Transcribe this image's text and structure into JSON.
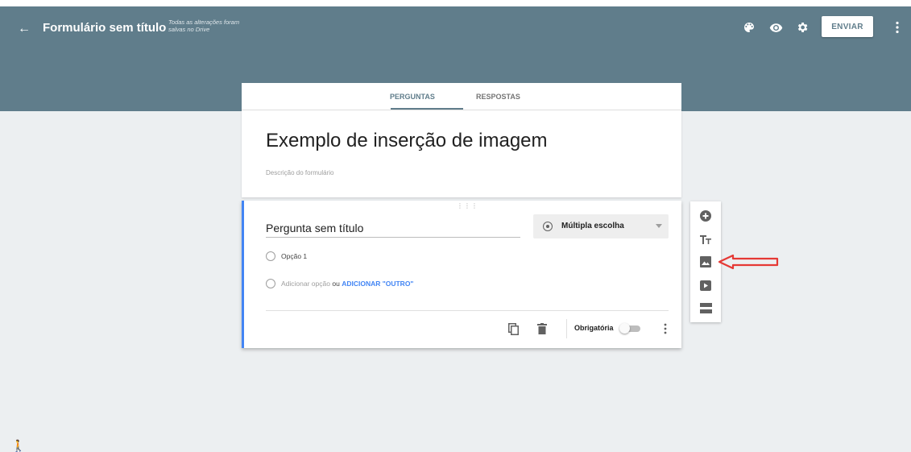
{
  "header": {
    "title": "Formulário sem título",
    "save_status": "Todas as alterações foram salvas no Drive",
    "send_label": "ENVIAR",
    "icons": [
      "back-arrow-icon",
      "palette-icon",
      "preview-eye-icon",
      "settings-gear-icon",
      "more-vert-icon"
    ]
  },
  "tabs": [
    {
      "label": "PERGUNTAS",
      "active": true
    },
    {
      "label": "RESPOSTAS",
      "active": false
    }
  ],
  "form": {
    "heading": "Exemplo de inserção de imagem",
    "description_placeholder": "Descrição do formulário"
  },
  "question": {
    "title": "Pergunta sem título",
    "type": "Múltipla escolha",
    "options": [
      "Opção 1"
    ],
    "add_option": "Adicionar opção",
    "or": "ou",
    "add_other": "ADICIONAR \"OUTRO\"",
    "required_label": "Obrigatória",
    "required": false
  },
  "toolbar": {
    "tools": [
      "add-question-icon",
      "add-title-text-icon",
      "add-image-icon",
      "add-video-icon",
      "add-section-icon"
    ]
  },
  "colors": {
    "header": "#607d8b",
    "background": "#eceff1",
    "accent_blue": "#4285f4",
    "annotation_red": "#e53935"
  }
}
